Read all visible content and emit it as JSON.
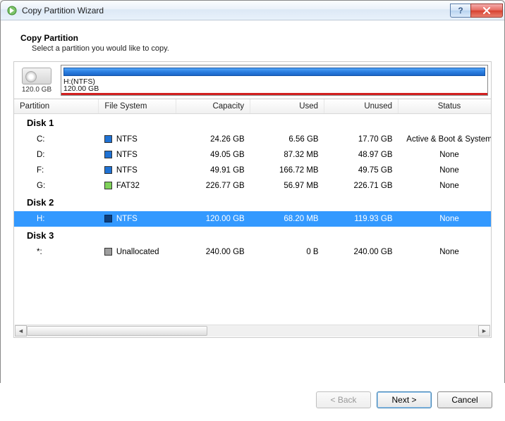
{
  "titlebar": {
    "title": "Copy Partition Wizard"
  },
  "header": {
    "title": "Copy Partition",
    "subtitle": "Select a partition you would like to copy."
  },
  "preview": {
    "disk_total": "120.0 GB",
    "selected_label": "H:(NTFS)",
    "selected_size": "120.00 GB"
  },
  "columns": {
    "partition": "Partition",
    "fs": "File System",
    "capacity": "Capacity",
    "used": "Used",
    "unused": "Unused",
    "status": "Status"
  },
  "groups": [
    {
      "name": "Disk 1",
      "rows": [
        {
          "partition": "C:",
          "fs": "NTFS",
          "swatch": "ntfs",
          "capacity": "24.26 GB",
          "used": "6.56 GB",
          "unused": "17.70 GB",
          "status": "Active & Boot & System"
        },
        {
          "partition": "D:",
          "fs": "NTFS",
          "swatch": "ntfs",
          "capacity": "49.05 GB",
          "used": "87.32 MB",
          "unused": "48.97 GB",
          "status": "None"
        },
        {
          "partition": "F:",
          "fs": "NTFS",
          "swatch": "ntfs",
          "capacity": "49.91 GB",
          "used": "166.72 MB",
          "unused": "49.75 GB",
          "status": "None"
        },
        {
          "partition": "G:",
          "fs": "FAT32",
          "swatch": "fat32",
          "capacity": "226.77 GB",
          "used": "56.97 MB",
          "unused": "226.71 GB",
          "status": "None"
        }
      ]
    },
    {
      "name": "Disk 2",
      "rows": [
        {
          "partition": "H:",
          "fs": "NTFS",
          "swatch": "sel",
          "capacity": "120.00 GB",
          "used": "68.20 MB",
          "unused": "119.93 GB",
          "status": "None",
          "selected": true
        }
      ]
    },
    {
      "name": "Disk 3",
      "rows": [
        {
          "partition": "*:",
          "fs": "Unallocated",
          "swatch": "unalloc",
          "capacity": "240.00 GB",
          "used": "0 B",
          "unused": "240.00 GB",
          "status": "None"
        }
      ]
    }
  ],
  "buttons": {
    "back": "< Back",
    "next": "Next >",
    "cancel": "Cancel"
  }
}
